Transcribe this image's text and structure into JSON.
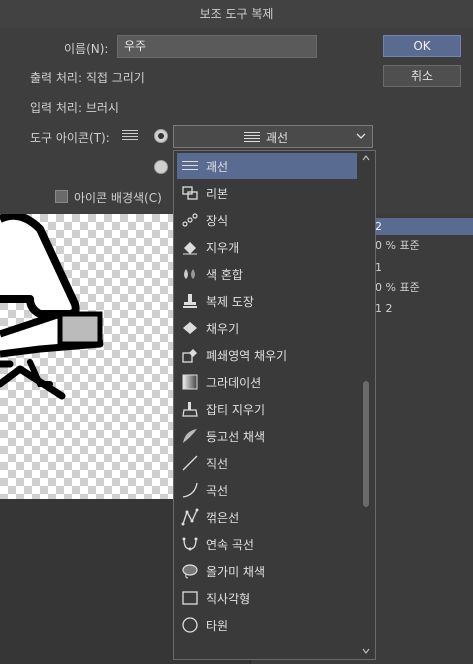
{
  "dialog": {
    "title": "보조 도구 복제",
    "name_label": "이름(N):",
    "name_value": "우주",
    "output_label": "출력 처리: 직접 그리기",
    "input_label": "입력 처리: 브러시",
    "tool_icon_label": "도구 아이콘(T):",
    "icon_bg_label": "아이콘 배경색(C)",
    "ok_label": "OK",
    "cancel_label": "취소",
    "selected_icon": "괘선"
  },
  "icon_list": [
    {
      "label": "괘선",
      "icon": "lines-icon",
      "selected": true
    },
    {
      "label": "리본",
      "icon": "ribbon-icon"
    },
    {
      "label": "장식",
      "icon": "decoration-icon"
    },
    {
      "label": "지우개",
      "icon": "eraser-icon"
    },
    {
      "label": "색 혼합",
      "icon": "color-mix-icon"
    },
    {
      "label": "복제 도장",
      "icon": "stamp-icon"
    },
    {
      "label": "채우기",
      "icon": "fill-icon"
    },
    {
      "label": "폐쇄영역 채우기",
      "icon": "closed-fill-icon"
    },
    {
      "label": "그라데이션",
      "icon": "gradient-icon"
    },
    {
      "label": "잡티 지우기",
      "icon": "dust-eraser-icon"
    },
    {
      "label": "등고선 채색",
      "icon": "contour-icon"
    },
    {
      "label": "직선",
      "icon": "straight-line-icon"
    },
    {
      "label": "곡선",
      "icon": "curve-icon"
    },
    {
      "label": "꺾은선",
      "icon": "polyline-icon"
    },
    {
      "label": "연속 곡선",
      "icon": "continuous-curve-icon"
    },
    {
      "label": "올가미 채색",
      "icon": "lasso-fill-icon"
    },
    {
      "label": "직사각형",
      "icon": "rectangle-icon"
    },
    {
      "label": "타원",
      "icon": "ellipse-icon"
    }
  ],
  "right_panel": {
    "rows": [
      "2",
      "0 % 표준",
      "1",
      "0 % 표준",
      "1 2"
    ]
  },
  "colors": {
    "accent": "#5a6b92",
    "dialog_bg": "#3e3e3e"
  }
}
